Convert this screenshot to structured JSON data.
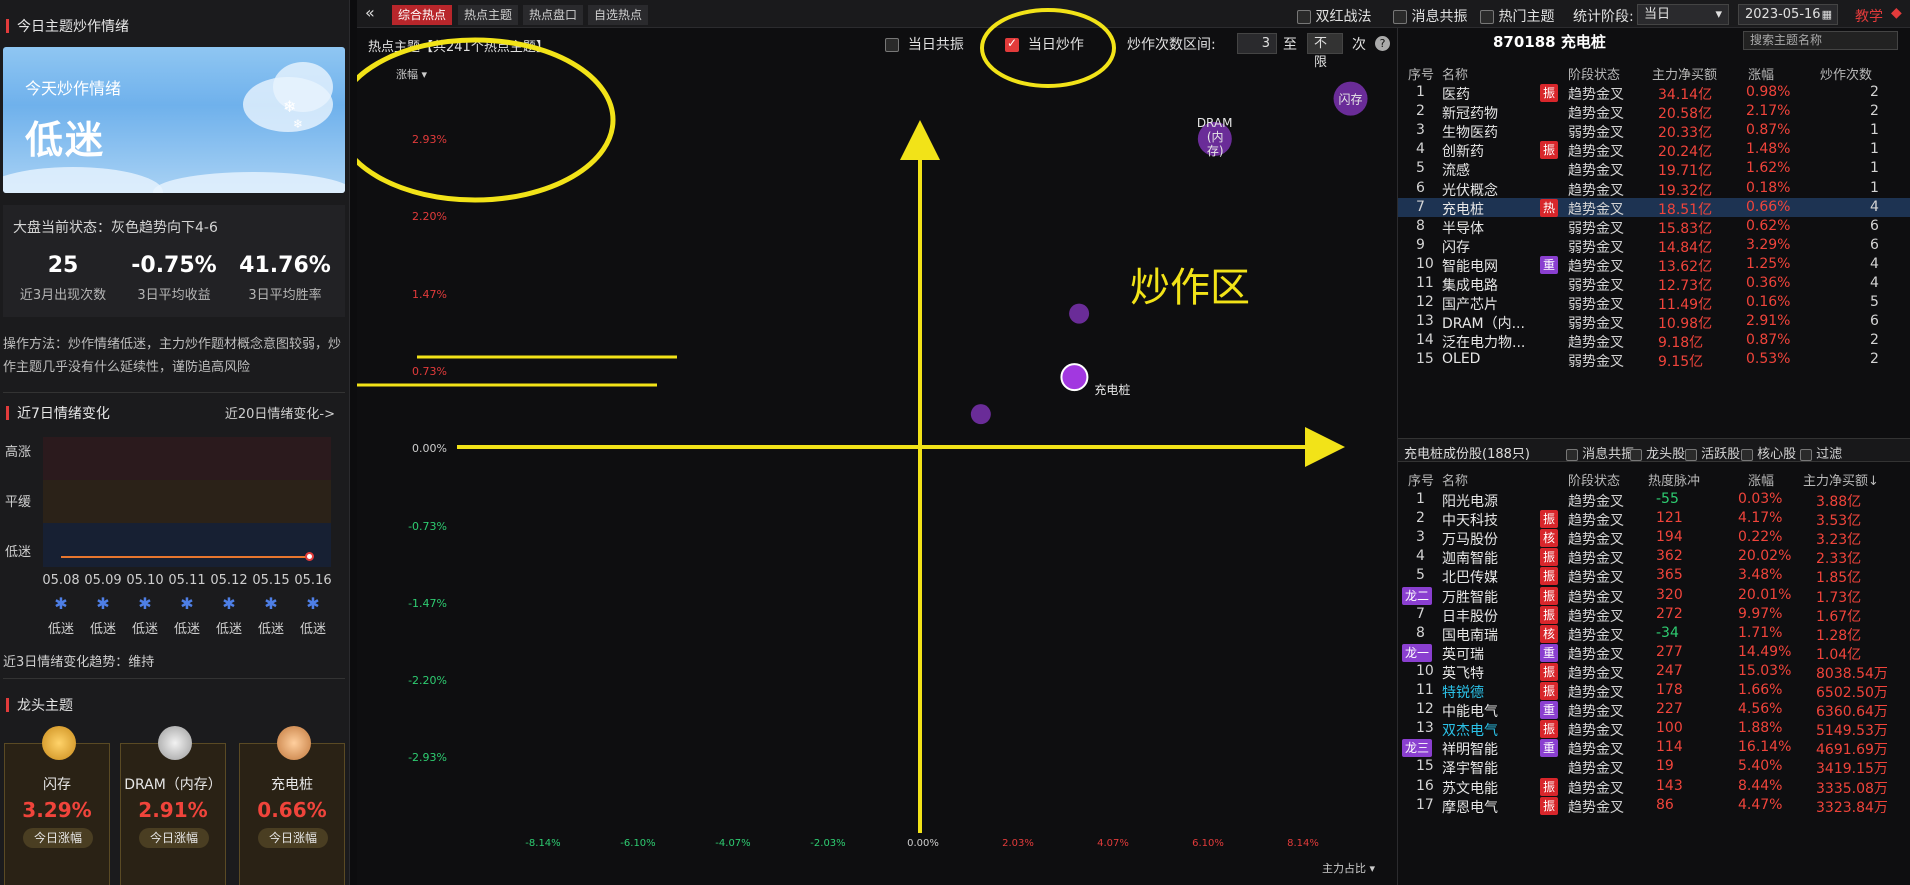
{
  "topbar": {
    "tabs": [
      "综合热点",
      "热点主题",
      "热点盘口",
      "自选热点"
    ],
    "active_tab": 0,
    "checks": [
      "双红战法",
      "消息共振",
      "热门主题"
    ],
    "stat_label": "统计阶段:",
    "stat_value": "当日",
    "date": "2023-05-16",
    "help": "教学"
  },
  "left": {
    "title": "今日主题炒作情绪",
    "mood_sub": "今天炒作情绪",
    "mood_main": "低迷",
    "market_state": "大盘当前状态：灰色趋势向下4-6",
    "stats": [
      {
        "v": "25",
        "l": "近3月出现次数"
      },
      {
        "v": "-0.75%",
        "l": "3日平均收益"
      },
      {
        "v": "41.76%",
        "l": "3日平均胜率"
      }
    ],
    "method": "操作方法：炒作情绪低迷，主力炒作题材概念意图较弱，炒作主题几乎没有什么延续性，谨防追高风险",
    "mood7_title": "近7日情绪变化",
    "mood7_more": "近20日情绪变化->",
    "levels": [
      "高涨",
      "平缓",
      "低迷"
    ],
    "dates": [
      "05.08",
      "05.09",
      "05.10",
      "05.11",
      "05.12",
      "05.15",
      "05.16"
    ],
    "moods": [
      "低迷",
      "低迷",
      "低迷",
      "低迷",
      "低迷",
      "低迷",
      "低迷"
    ],
    "trend": "近3日情绪变化趋势：维持",
    "leader_title": "龙头主题",
    "leaders": [
      {
        "name": "闪存",
        "pct": "3.29%",
        "btn": "今日涨幅"
      },
      {
        "name": "DRAM（内存）",
        "pct": "2.91%",
        "btn": "今日涨幅"
      },
      {
        "name": "充电桩",
        "pct": "0.66%",
        "btn": "今日涨幅"
      }
    ]
  },
  "center": {
    "head": "热点主题【共241个热点主题】",
    "resonance": "当日共振",
    "hype": "当日炒作",
    "range_label": "炒作次数区间:",
    "range_from": "3",
    "range_to_word": "至",
    "range_to": "不限",
    "range_unit": "次",
    "yaxis_label": "涨幅",
    "xaxis_label": "主力占比",
    "annot": "炒作区",
    "bubbles": [
      {
        "label": "闪存"
      },
      {
        "label": "DRAM\n(内\n存)"
      },
      {
        "label": "充电桩"
      }
    ]
  },
  "chart_data": {
    "type": "scatter",
    "yticks": [
      "2.93%",
      "2.20%",
      "1.47%",
      "0.73%",
      "0.00%",
      "-0.73%",
      "-1.47%",
      "-2.20%",
      "-2.93%"
    ],
    "xticks": [
      "-8.14%",
      "-6.10%",
      "-4.07%",
      "-2.03%",
      "0.00%",
      "2.03%",
      "4.07%",
      "6.10%",
      "8.14%"
    ],
    "points": [
      {
        "name": "闪存",
        "x": 9.2,
        "y": 3.29
      },
      {
        "name": "DRAM（内存）",
        "x": 6.3,
        "y": 2.91
      },
      {
        "name": "充电桩",
        "x": 3.3,
        "y": 0.66
      },
      {
        "name": "",
        "x": 3.4,
        "y": 1.26
      },
      {
        "name": "",
        "x": 1.3,
        "y": 0.31
      }
    ]
  },
  "right": {
    "code_title": "870188 充电桩",
    "search_ph": "搜索主题名称",
    "top_headers": [
      "序号",
      "名称",
      "阶段状态",
      "主力净买额",
      "涨幅",
      "炒作次数"
    ],
    "top_rows": [
      [
        "1",
        "医药",
        "振",
        "趋势金叉",
        "34.14亿",
        "0.98%",
        "2"
      ],
      [
        "2",
        "新冠药物",
        "",
        "趋势金叉",
        "20.58亿",
        "2.17%",
        "2"
      ],
      [
        "3",
        "生物医药",
        "",
        "弱势金叉",
        "20.33亿",
        "0.87%",
        "1"
      ],
      [
        "4",
        "创新药",
        "振",
        "趋势金叉",
        "20.24亿",
        "1.48%",
        "1"
      ],
      [
        "5",
        "流感",
        "",
        "趋势金叉",
        "19.71亿",
        "1.62%",
        "1"
      ],
      [
        "6",
        "光伏概念",
        "",
        "趋势金叉",
        "19.32亿",
        "0.18%",
        "1"
      ],
      [
        "7",
        "充电桩",
        "热",
        "趋势金叉",
        "18.51亿",
        "0.66%",
        "4"
      ],
      [
        "8",
        "半导体",
        "",
        "弱势金叉",
        "15.83亿",
        "0.62%",
        "6"
      ],
      [
        "9",
        "闪存",
        "",
        "弱势金叉",
        "14.84亿",
        "3.29%",
        "6"
      ],
      [
        "10",
        "智能电网",
        "重",
        "趋势金叉",
        "13.62亿",
        "1.25%",
        "4"
      ],
      [
        "11",
        "集成电路",
        "",
        "弱势金叉",
        "12.73亿",
        "0.36%",
        "4"
      ],
      [
        "12",
        "国产芯片",
        "",
        "弱势金叉",
        "11.49亿",
        "0.16%",
        "5"
      ],
      [
        "13",
        "DRAM（内...",
        "",
        "弱势金叉",
        "10.98亿",
        "2.91%",
        "6"
      ],
      [
        "14",
        "泛在电力物...",
        "",
        "趋势金叉",
        "9.18亿",
        "0.87%",
        "2"
      ],
      [
        "15",
        "OLED",
        "",
        "弱势金叉",
        "9.15亿",
        "0.53%",
        "2"
      ]
    ],
    "sub_title": "充电桩成份股(188只)",
    "sub_checks": [
      "消息共振",
      "龙头股",
      "活跃股",
      "核心股",
      "过滤"
    ],
    "bot_headers": [
      "序号",
      "名称",
      "阶段状态",
      "热度脉冲",
      "涨幅",
      "主力净买额↓"
    ],
    "bot_rows": [
      [
        "1",
        "",
        "阳光电源",
        "",
        "趋势金叉",
        "-55",
        "0.03%",
        "3.88亿"
      ],
      [
        "2",
        "",
        "中天科技",
        "振",
        "趋势金叉",
        "121",
        "4.17%",
        "3.53亿"
      ],
      [
        "3",
        "",
        "万马股份",
        "核",
        "趋势金叉",
        "194",
        "0.22%",
        "3.23亿"
      ],
      [
        "4",
        "",
        "迦南智能",
        "振",
        "趋势金叉",
        "362",
        "20.02%",
        "2.33亿"
      ],
      [
        "5",
        "",
        "北巴传媒",
        "振",
        "趋势金叉",
        "365",
        "3.48%",
        "1.85亿"
      ],
      [
        "6",
        "龙二",
        "万胜智能",
        "振",
        "趋势金叉",
        "320",
        "20.01%",
        "1.73亿"
      ],
      [
        "7",
        "",
        "日丰股份",
        "振",
        "趋势金叉",
        "272",
        "9.97%",
        "1.67亿"
      ],
      [
        "8",
        "",
        "国电南瑞",
        "核",
        "趋势金叉",
        "-34",
        "1.71%",
        "1.28亿"
      ],
      [
        "9",
        "龙一",
        "英可瑞",
        "重",
        "趋势金叉",
        "277",
        "14.49%",
        "1.04亿"
      ],
      [
        "10",
        "",
        "英飞特",
        "振",
        "趋势金叉",
        "247",
        "15.03%",
        "8038.54万"
      ],
      [
        "11",
        "",
        "特锐德",
        "振",
        "趋势金叉",
        "178",
        "1.66%",
        "6502.50万"
      ],
      [
        "12",
        "",
        "中能电气",
        "重",
        "趋势金叉",
        "227",
        "4.56%",
        "6360.64万"
      ],
      [
        "13",
        "",
        "双杰电气",
        "振",
        "趋势金叉",
        "100",
        "1.88%",
        "5149.53万"
      ],
      [
        "14",
        "龙三",
        "祥明智能",
        "重",
        "趋势金叉",
        "114",
        "16.14%",
        "4691.69万"
      ],
      [
        "15",
        "",
        "泽宇智能",
        "",
        "趋势金叉",
        "19",
        "5.40%",
        "3419.15万"
      ],
      [
        "16",
        "",
        "苏文电能",
        "振",
        "趋势金叉",
        "143",
        "8.44%",
        "3335.08万"
      ],
      [
        "17",
        "",
        "摩恩电气",
        "振",
        "趋势金叉",
        "86",
        "4.47%",
        "3323.84万"
      ]
    ]
  }
}
